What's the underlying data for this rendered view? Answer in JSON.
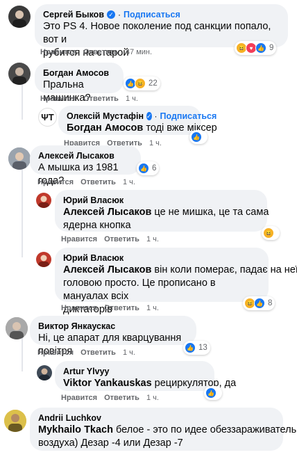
{
  "actions": {
    "like": "Нравится",
    "reply": "Ответить",
    "dot": "·"
  },
  "comments": [
    {
      "author": "Сергей Быков",
      "follow": "Подписаться",
      "text_lines": [
        "Это PS 4. Новое поколение под санкции попало, вот и",
        "рубится на старой"
      ],
      "time": "47 мин.",
      "reactions": {
        "icons": [
          "haha",
          "love",
          "like"
        ],
        "count": "9"
      }
    },
    {
      "author": "Богдан Амосов",
      "text_lines": [
        "Пральна машинка?"
      ],
      "time": "1 ч.",
      "reactions": {
        "icons": [
          "like",
          "haha"
        ],
        "count": "22"
      }
    },
    {
      "author": "Олексій Мустафін",
      "follow": "Подписаться",
      "mention": "Богдан Амосов",
      "text_lines": [
        " тоді вже міксер"
      ],
      "time": "1 ч.",
      "reactions": {
        "icons": [
          "like"
        ],
        "count": ""
      }
    },
    {
      "author": "Алексей Лысаков",
      "text_lines": [
        "А мышка из 1981 года?"
      ],
      "time": "1 ч.",
      "reactions": {
        "icons": [
          "like"
        ],
        "count": "6"
      }
    },
    {
      "author": "Юрий Власюк",
      "mention": "Алексей Лысаков",
      "text_lines": [
        " це не мишка, це та сама",
        "ядерна кнопка"
      ],
      "time": "1 ч.",
      "reactions": {
        "icons": [
          "haha"
        ],
        "count": ""
      }
    },
    {
      "author": "Юрий Власюк",
      "mention": "Алексей Лысаков",
      "text_lines": [
        " він коли померає, падає на неї",
        "головою просто. Це прописано в мануалах всіх",
        "диктаторів"
      ],
      "time": "1 ч.",
      "reactions": {
        "icons": [
          "haha",
          "like"
        ],
        "count": "8"
      }
    },
    {
      "author": "Виктор Янкаускас",
      "text_lines": [
        "Ні, це апарат для кварцування повітря"
      ],
      "time": "1 ч.",
      "reactions": {
        "icons": [
          "like"
        ],
        "count": "13"
      }
    },
    {
      "author": "Artur Ylvyy",
      "mention": "Viktor Yankauskas",
      "text_lines": [
        " рециркулятор, да"
      ],
      "time": "1 ч.",
      "reactions": {
        "icons": [
          "like"
        ],
        "count": ""
      }
    },
    {
      "author": "Andrii Luchkov",
      "mention": "Mykhailo Tkach",
      "text_lines": [
        " белое - это по идее обеззараживатель",
        "воздуха) Дезар -4 или Дезар -7"
      ],
      "time": "",
      "reactions": null
    }
  ],
  "colors": {
    "like": "#1877f2",
    "haha": "#f7b125",
    "bubble": "#f0f2f5",
    "meta": "#65676b"
  }
}
